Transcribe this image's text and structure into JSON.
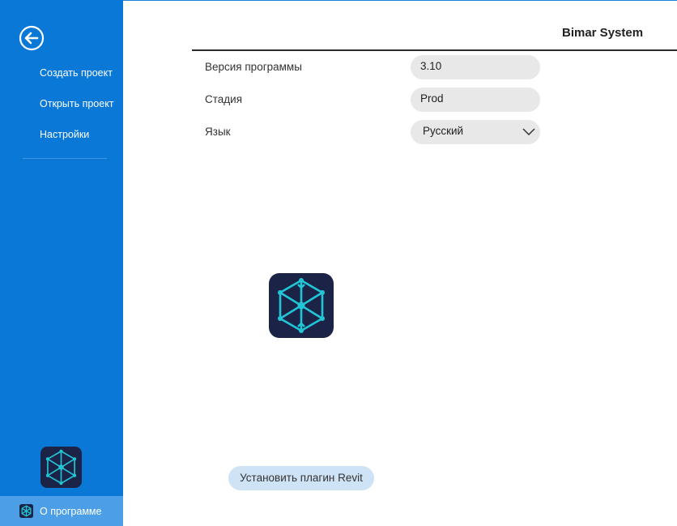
{
  "sidebar": {
    "back_icon": "back-arrow-icon",
    "items": [
      {
        "label": "Создать проект"
      },
      {
        "label": "Открыть проект"
      },
      {
        "label": "Настройки"
      }
    ],
    "logo_icon": "cube-hexagon-logo-icon",
    "about": {
      "label": "О программе",
      "icon": "cube-hexagon-logo-icon",
      "selected": true
    }
  },
  "header": {
    "title": "Bimar System"
  },
  "form": {
    "version": {
      "label": "Версия программы",
      "value": "3.10"
    },
    "stage": {
      "label": "Стадия",
      "value": "Prod"
    },
    "language": {
      "label": "Язык",
      "value": "Русский"
    }
  },
  "main": {
    "install_button_label": "Установить плагин Revit"
  },
  "colors": {
    "sidebar_bg": "#0a78d6",
    "sidebar_selected_bg": "#4c9fe6",
    "logo_bg": "#1b2347",
    "logo_accent": "#21c5d6",
    "field_bg": "#e8e8e8",
    "install_button_bg": "#cfe3f7"
  }
}
